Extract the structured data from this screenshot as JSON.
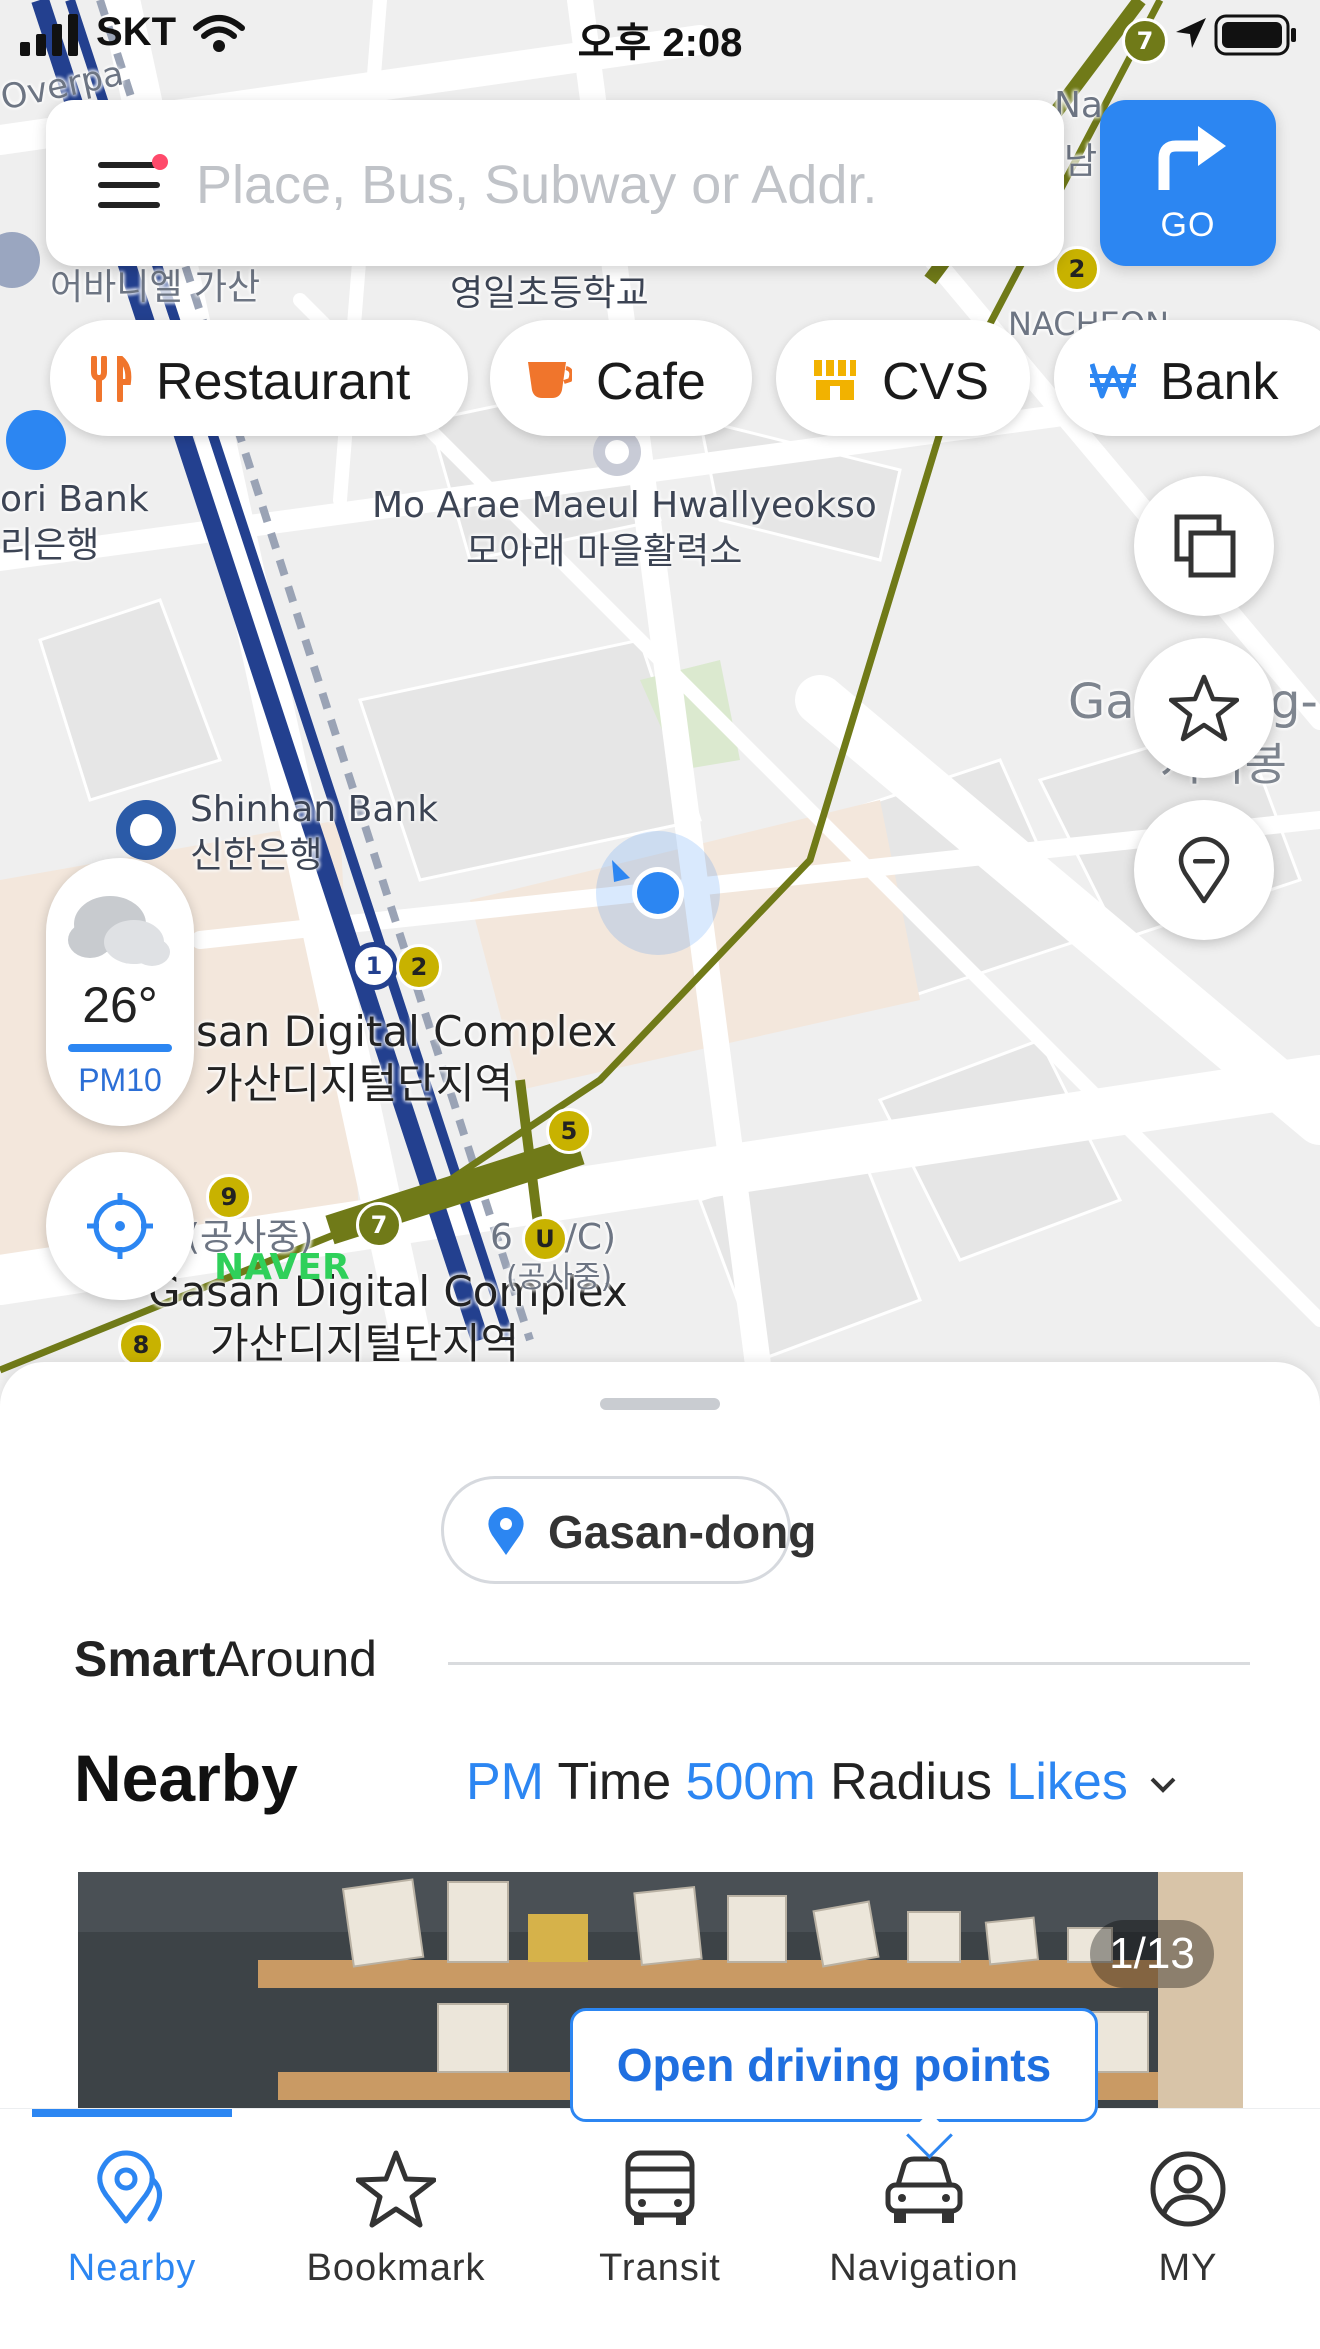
{
  "status_bar": {
    "carrier": "SKT",
    "time": "오후 2:08"
  },
  "search": {
    "placeholder": "Place, Bus, Subway or Addr.",
    "go_label": "GO"
  },
  "categories": [
    {
      "label": "Restaurant",
      "icon": "fork-knife-icon",
      "color": "#f0752c"
    },
    {
      "label": "Cafe",
      "icon": "coffee-cup-icon",
      "color": "#f0752c"
    },
    {
      "label": "CVS",
      "icon": "store-icon",
      "color": "#f2b200"
    },
    {
      "label": "Bank",
      "icon": "won-icon",
      "color": "#2c86f2"
    }
  ],
  "map": {
    "labels": {
      "school": "영일초등학교",
      "venue_en": "Mo Arae Maeul Hwallyeokso",
      "venue_ko": "모아래 마을활력소",
      "bank_left_en": "ori Bank",
      "bank_left_ko": "리은행",
      "top_left": "어바니엘 가산",
      "shinhan_en": "Shinhan Bank",
      "shinhan_ko": "신한은행",
      "station_en": "san Digital Complex",
      "station_ko": "가산디지털단지역",
      "station2_en": "Gasan Digital Complex",
      "station2_ko": "가산디지털단지역",
      "construction_left": "(공사중)",
      "construction_right": "6 (U/C)",
      "construction_right2": "(공사중)",
      "right_edge": "Ga",
      "right_edge2": "g-",
      "right_edge_ko": "시리봉",
      "top_right": "Na",
      "top_right_ko": "남",
      "nacheon": "NACHEON",
      "overpass": "Overpa",
      "brand": "NAVER"
    },
    "station_numbers": [
      "1",
      "2",
      "5",
      "7",
      "8",
      "9",
      "U",
      "2",
      "7"
    ]
  },
  "weather": {
    "temperature": "26°",
    "air": "PM10"
  },
  "sheet": {
    "location": "Gasan-dong",
    "smart_bold": "Smart",
    "smart_rest": "Around",
    "nearby_title": "Nearby",
    "filter_1_value": "PM",
    "filter_1_label": "Time",
    "filter_2_value": "500m",
    "filter_2_label": "Radius",
    "filter_3_value": "Likes",
    "photo_counter": "1/13",
    "tooltip": "Open driving points"
  },
  "tabs": [
    {
      "label": "Nearby",
      "icon": "nearby-pin-icon",
      "active": true
    },
    {
      "label": "Bookmark",
      "icon": "star-icon",
      "active": false
    },
    {
      "label": "Transit",
      "icon": "bus-icon",
      "active": false
    },
    {
      "label": "Navigation",
      "icon": "car-icon",
      "active": false
    },
    {
      "label": "MY",
      "icon": "user-icon",
      "active": false
    }
  ]
}
